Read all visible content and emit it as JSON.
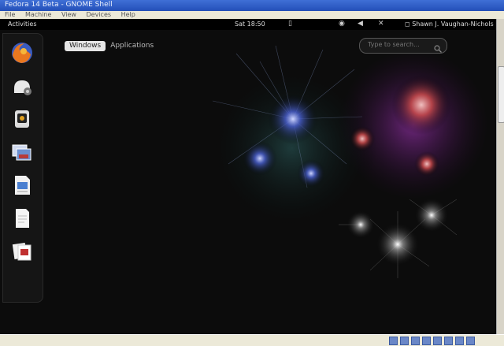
{
  "window": {
    "title": "Fedora 14 Beta - GNOME Shell"
  },
  "menubar": {
    "items": [
      "File",
      "Machine",
      "View",
      "Devices",
      "Help"
    ]
  },
  "topbar": {
    "activities": "Activities",
    "clock": "Sat 18:50",
    "user": "Shawn J. Vaughan-Nichols"
  },
  "overview": {
    "tabs": {
      "windows": "Windows",
      "applications": "Applications"
    },
    "search": {
      "placeholder": "Type to search..."
    }
  },
  "dash": {
    "icons": [
      "firefox-icon",
      "evolution-icon",
      "empathy-icon",
      "shotwell-icon",
      "writer-document-icon",
      "text-document-icon",
      "image-viewer-icon"
    ]
  },
  "colors": {
    "topbar": "#000000",
    "overview_bg": "#0c0c0c",
    "windows_tab_bg": "#e6e6e6",
    "firework_blue": "#4a5fd0",
    "firework_red": "#c84a4a",
    "firework_purple": "#5a1a6a"
  }
}
